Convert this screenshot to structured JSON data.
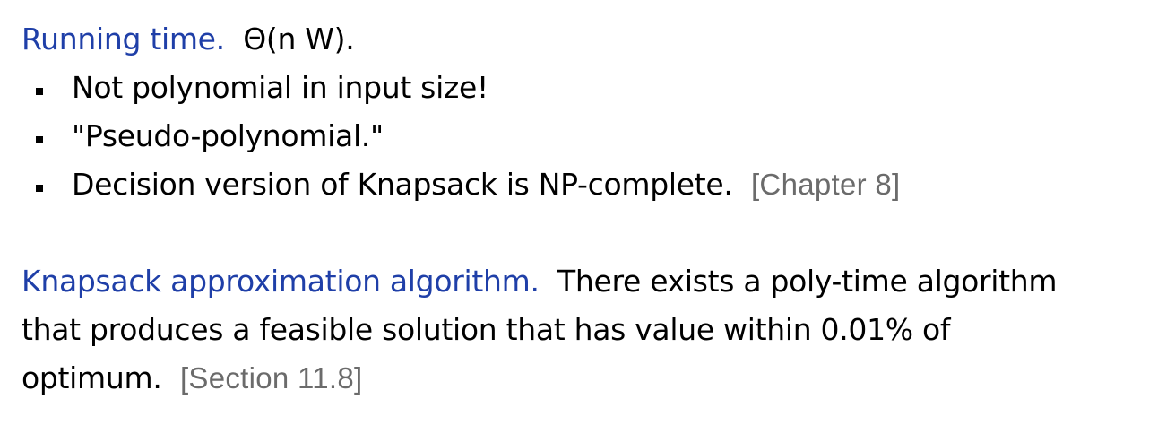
{
  "running_time": {
    "heading": "Running time.",
    "complexity": "Θ(n W)."
  },
  "bullets": [
    {
      "text": "Not polynomial in input size!",
      "ref": ""
    },
    {
      "text": "\"Pseudo-polynomial.\"",
      "ref": ""
    },
    {
      "text": "Decision version of Knapsack is NP-complete.",
      "ref": "[Chapter 8]"
    }
  ],
  "approximation": {
    "heading": "Knapsack approximation algorithm.",
    "line1": "There exists a poly-time algorithm",
    "line2": "that produces a feasible solution that has value within 0.01% of",
    "line3": "optimum.",
    "ref": "[Section 11.8]"
  }
}
